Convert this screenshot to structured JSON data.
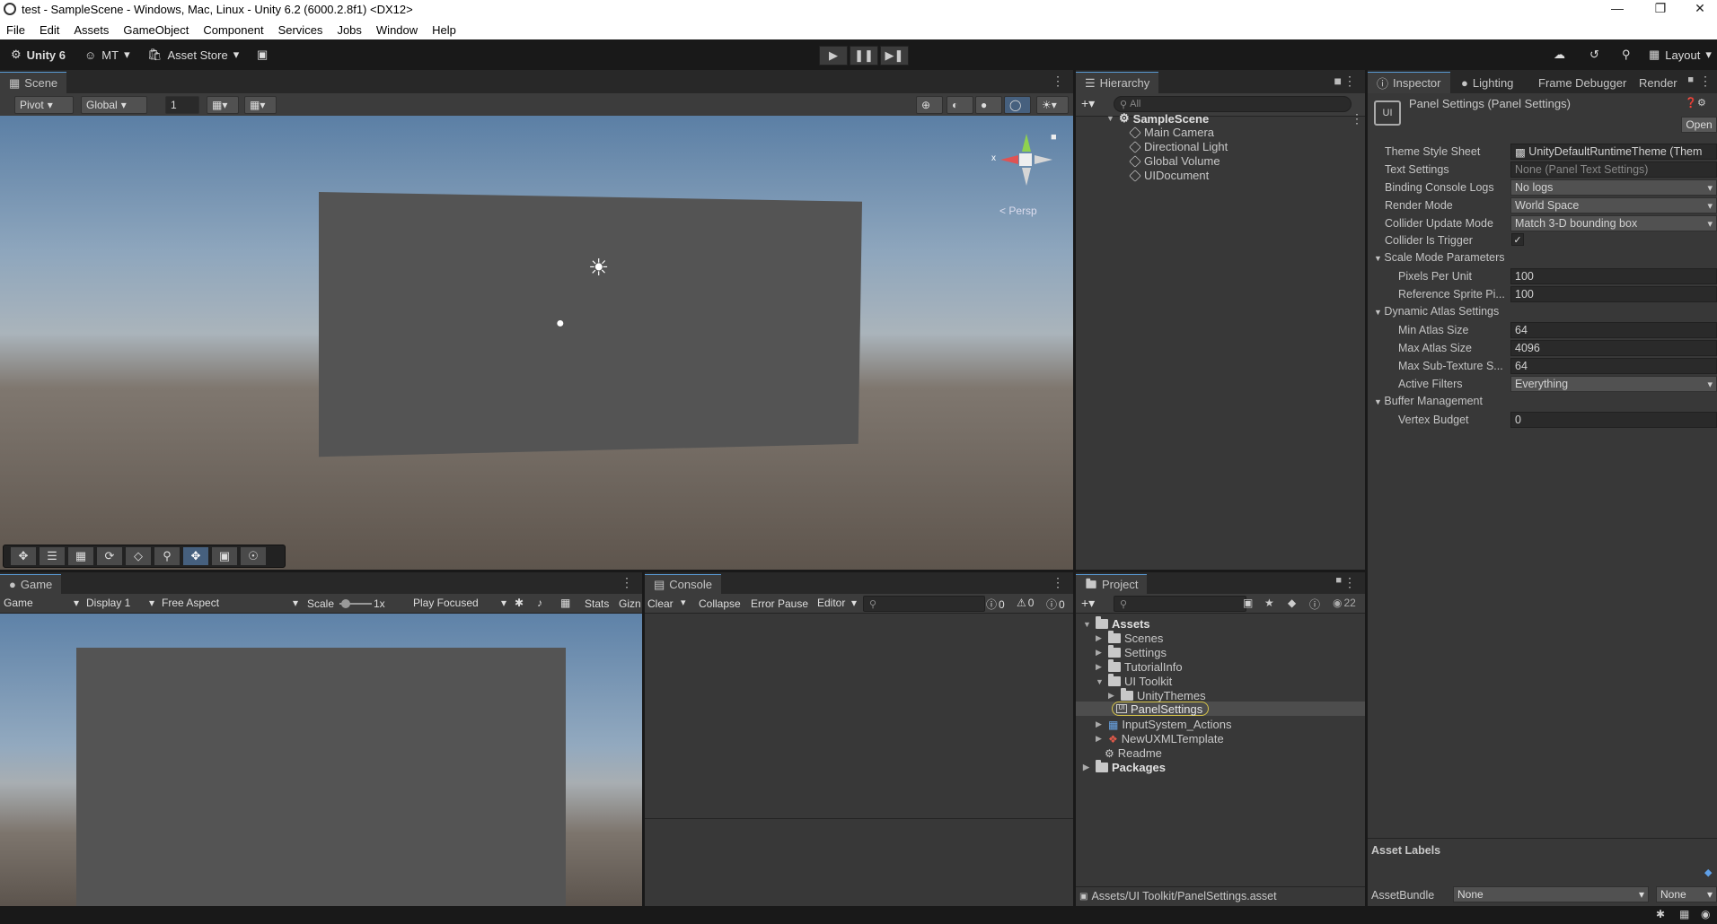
{
  "window": {
    "title": "test - SampleScene - Windows, Mac, Linux - Unity 6.2 (6000.2.8f1) <DX12>"
  },
  "menu": [
    "File",
    "Edit",
    "Assets",
    "GameObject",
    "Component",
    "Services",
    "Jobs",
    "Window",
    "Help"
  ],
  "toolbar": {
    "unity": "Unity 6",
    "account": "MT",
    "asset_store": "Asset Store",
    "layout": "Layout"
  },
  "scene": {
    "tab": "Scene",
    "pivot": "Pivot",
    "global": "Global",
    "grid_snap": "1",
    "persp": "< Persp",
    "gizmo_x": "x"
  },
  "hierarchy": {
    "tab": "Hierarchy",
    "search_placeholder": "All",
    "scene_name": "SampleScene",
    "items": [
      "Main Camera",
      "Directional Light",
      "Global Volume",
      "UIDocument"
    ]
  },
  "inspector": {
    "tabs": [
      "Inspector",
      "Lighting",
      "Frame Debugger",
      "Render"
    ],
    "title": "Panel Settings (Panel Settings)",
    "open": "Open",
    "rows": [
      {
        "label": "Theme Style Sheet",
        "value": "UnityDefaultRuntimeTheme (Them"
      },
      {
        "label": "Text Settings",
        "value": "None (Panel Text Settings)"
      },
      {
        "label": "Binding Console Logs",
        "value": "No logs"
      },
      {
        "label": "Render Mode",
        "value": "World Space"
      },
      {
        "label": "Collider Update Mode",
        "value": "Match 3-D bounding box"
      },
      {
        "label": "Collider Is Trigger",
        "value": "✓"
      }
    ],
    "scale_header": "Scale Mode Parameters",
    "scale_rows": [
      {
        "label": "Pixels Per Unit",
        "value": "100"
      },
      {
        "label": "Reference Sprite Pi...",
        "value": "100"
      }
    ],
    "atlas_header": "Dynamic Atlas Settings",
    "atlas_rows": [
      {
        "label": "Min Atlas Size",
        "value": "64"
      },
      {
        "label": "Max Atlas Size",
        "value": "4096"
      },
      {
        "label": "Max Sub-Texture S...",
        "value": "64"
      },
      {
        "label": "Active Filters",
        "value": "Everything"
      }
    ],
    "buffer_header": "Buffer Management",
    "buffer_rows": [
      {
        "label": "Vertex Budget",
        "value": "0"
      }
    ],
    "asset_labels": "Asset Labels",
    "assetbundle": "AssetBundle",
    "bundle_value": "None",
    "bundle_variant": "None"
  },
  "game": {
    "tab": "Game",
    "mode": "Game",
    "display": "Display 1",
    "aspect": "Free Aspect",
    "scale_label": "Scale",
    "scale_value": "1x",
    "play_focused": "Play Focused",
    "stats": "Stats",
    "gizmos": "Gizn"
  },
  "console": {
    "tab": "Console",
    "clear": "Clear",
    "collapse": "Collapse",
    "error_pause": "Error Pause",
    "editor": "Editor",
    "counts": [
      "0",
      "0",
      "0"
    ]
  },
  "project": {
    "tab": "Project",
    "badge": "22",
    "root": "Assets",
    "items": [
      "Scenes",
      "Settings",
      "TutorialInfo",
      "UI Toolkit",
      "UnityThemes",
      "PanelSettings",
      "InputSystem_Actions",
      "NewUXMLTemplate",
      "Readme"
    ],
    "packages": "Packages",
    "path": "Assets/UI Toolkit/PanelSettings.asset"
  }
}
